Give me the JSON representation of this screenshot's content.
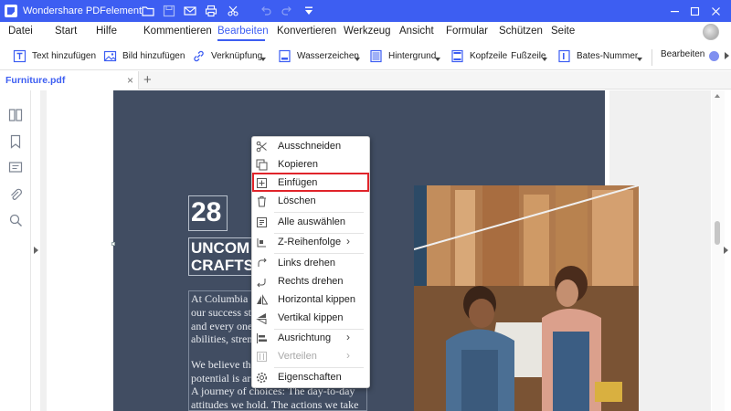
{
  "app": {
    "title": "Wondershare PDFelement"
  },
  "menu": {
    "items": [
      "Datei",
      "Start",
      "Hilfe",
      "Kommentieren",
      "Bearbeiten",
      "Konvertieren",
      "Werkzeug",
      "Ansicht",
      "Formular",
      "Schützen",
      "Seite"
    ],
    "active": "Bearbeiten"
  },
  "toolbar": {
    "text_add": "Text hinzufügen",
    "image_add": "Bild hinzufügen",
    "link": "Verknüpfung",
    "watermark": "Wasserzeichen",
    "background": "Hintergrund",
    "header": "Kopfzeile",
    "footer": "Fußzeile",
    "bates": "Bates-Nummer",
    "edit": "Bearbeiten"
  },
  "tab": {
    "filename": "Furniture.pdf",
    "close": "×",
    "new": "+"
  },
  "document": {
    "number": "28",
    "headline": [
      "UNCOM",
      "CRAFTS"
    ],
    "body": [
      "At Columbia",
      "our success sta",
      "and every one",
      "abilities, stren",
      "We believe tha",
      "potential is ar",
      "A journey of choices: The day-to-day",
      "attitudes we hold. The actions we take"
    ]
  },
  "context_menu": {
    "items": [
      {
        "label": "Ausschneiden",
        "icon": "scissors-icon",
        "enabled": true
      },
      {
        "label": "Kopieren",
        "icon": "copy-icon",
        "enabled": true
      },
      {
        "label": "Einfügen",
        "icon": "paste-icon",
        "enabled": true,
        "highlighted": true
      },
      {
        "label": "Löschen",
        "icon": "trash-icon",
        "enabled": true
      },
      {
        "label": "Alle auswählen",
        "icon": "select-all-icon",
        "enabled": true
      },
      {
        "label": "Z-Reihenfolge",
        "icon": "z-order-icon",
        "enabled": true,
        "submenu": true
      },
      {
        "label": "Links drehen",
        "icon": "rotate-left-icon",
        "enabled": true
      },
      {
        "label": "Rechts drehen",
        "icon": "rotate-right-icon",
        "enabled": true
      },
      {
        "label": "Horizontal kippen",
        "icon": "flip-horizontal-icon",
        "enabled": true
      },
      {
        "label": "Vertikal kippen",
        "icon": "flip-vertical-icon",
        "enabled": true
      },
      {
        "label": "Ausrichtung",
        "icon": "align-icon",
        "enabled": true,
        "submenu": true
      },
      {
        "label": "Verteilen",
        "icon": "distribute-icon",
        "enabled": false,
        "submenu": true
      },
      {
        "label": "Eigenschaften",
        "icon": "gear-icon",
        "enabled": true
      }
    ],
    "submenu_arrow": "›"
  },
  "colors": {
    "accent": "#3d5ef2",
    "page_dark": "#414d62",
    "highlight_border": "#e0242a"
  }
}
